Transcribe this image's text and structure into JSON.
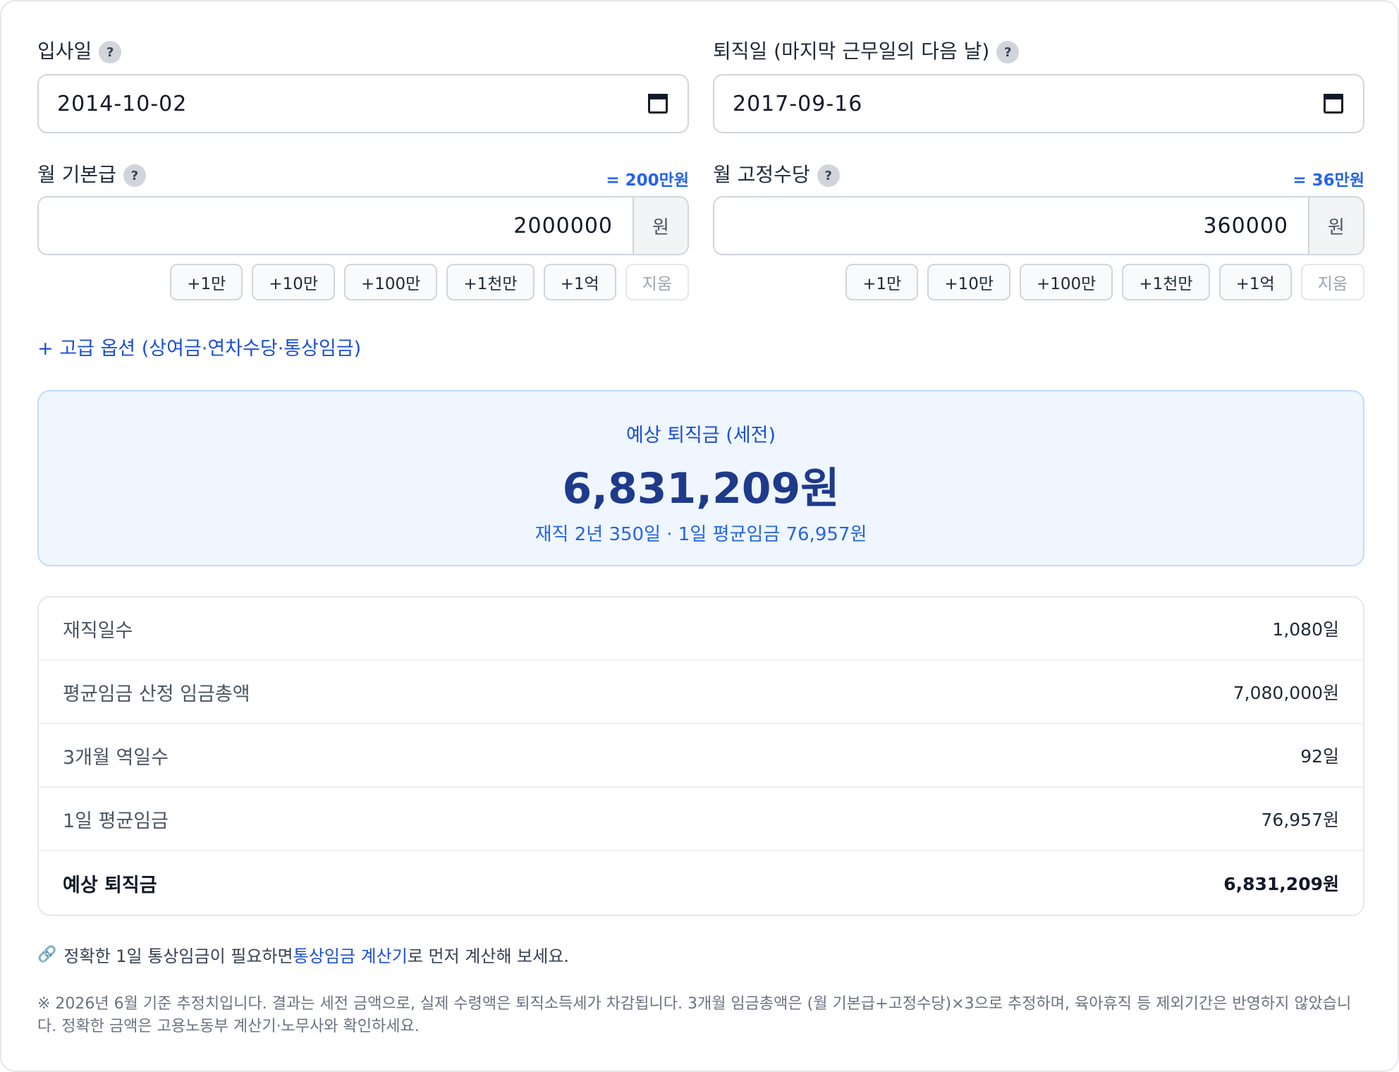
{
  "hire": {
    "label": "입사일",
    "help": "?",
    "value": "2014-10-02"
  },
  "leave": {
    "label": "퇴직일 (마지막 근무일의 다음 날)",
    "help": "?",
    "value": "2017-09-16"
  },
  "basePay": {
    "label": "월 기본급",
    "help": "?",
    "hint": "= 200만원",
    "value": "2000000",
    "unit": "원",
    "chips": [
      "+1만",
      "+10만",
      "+100만",
      "+1천만",
      "+1억"
    ],
    "clear": "지움"
  },
  "allowance": {
    "label": "월 고정수당",
    "help": "?",
    "hint": "= 36만원",
    "value": "360000",
    "unit": "원",
    "chips": [
      "+1만",
      "+10만",
      "+100만",
      "+1천만",
      "+1억"
    ],
    "clear": "지움"
  },
  "advanced": "+ 고급 옵션 (상여금·연차수당·통상임금)",
  "result": {
    "label": "예상 퇴직금 (세전)",
    "amount": "6,831,209원",
    "sub": "재직 2년 350일 · 1일 평균임금 76,957원"
  },
  "breakdown": [
    {
      "key": "재직일수",
      "value": "1,080일"
    },
    {
      "key": "평균임금 산정 임금총액",
      "value": "7,080,000원"
    },
    {
      "key": "3개월 역일수",
      "value": "92일"
    },
    {
      "key": "1일 평균임금",
      "value": "76,957원"
    },
    {
      "key": "예상 퇴직금",
      "value": "6,831,209원"
    }
  ],
  "note": {
    "icon": "🔗",
    "before": "정확한 1일 통상임금이 필요하면 ",
    "link": "통상임금 계산기",
    "after": "로 먼저 계산해 보세요."
  },
  "disclaimer": "※ 2026년 6월 기준 추정치입니다. 결과는 세전 금액으로, 실제 수령액은 퇴직소득세가 차감됩니다. 3개월 임금총액은 (월 기본급+고정수당)×3으로 추정하며, 육아휴직 등 제외기간은 반영하지 않았습니다. 정확한 금액은 고용노동부 계산기·노무사와 확인하세요."
}
